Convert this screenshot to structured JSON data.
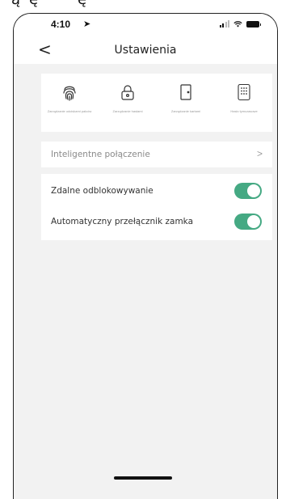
{
  "status_bar": {
    "time": "4:10",
    "location_glyph": "➤"
  },
  "header": {
    "back_glyph": "<",
    "title": "Ustawienia"
  },
  "features": [
    {
      "icon": "fingerprint-icon",
      "label": "Zarządzanie odciskami palców"
    },
    {
      "icon": "lock-icon",
      "label": "Zarządzanie hasłami"
    },
    {
      "icon": "door-card-icon",
      "label": "Zarządzanie kartami"
    },
    {
      "icon": "keypad-icon",
      "label": "Hasło tymczasowe"
    }
  ],
  "smart_connection": {
    "label": "Inteligentne połączenie",
    "chevron": ">"
  },
  "settings": [
    {
      "label": "Zdalne odblokowywanie",
      "enabled": true
    },
    {
      "label": "Automatyczny przełącznik zamka",
      "enabled": true
    }
  ],
  "colors": {
    "accent": "#45a983",
    "background": "#f2f2f2"
  }
}
